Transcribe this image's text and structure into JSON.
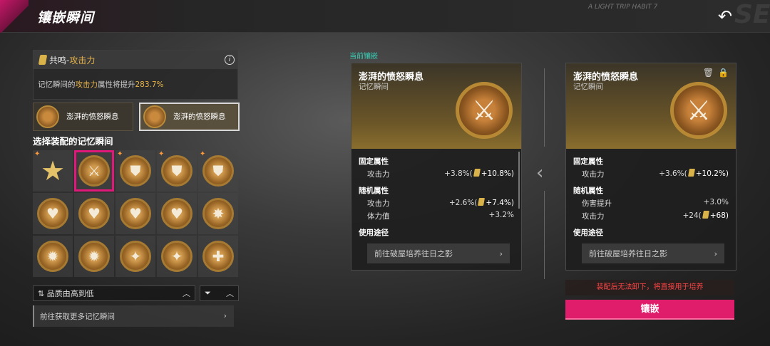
{
  "header": {
    "title": "镶嵌瞬间",
    "deco_text": "A LIGHT TRIP\nHABIT 7",
    "deco_letters": "SE"
  },
  "resonance": {
    "prefix": "共鸣-",
    "attribute": "攻击力",
    "desc_before": "记忆瞬间的",
    "desc_attr": "攻击力",
    "desc_middle": "属性将提升",
    "desc_value": "283.7%"
  },
  "slots": [
    {
      "label": "澎湃的愤怒瞬息"
    },
    {
      "label": "澎湃的愤怒瞬息"
    }
  ],
  "select_title": "选择装配的记忆瞬间",
  "grid": [
    {
      "icon": "star-icon",
      "glyph": "★",
      "new": true,
      "selected": false
    },
    {
      "icon": "sword-icon",
      "glyph": "⚔",
      "new": false,
      "selected": true
    },
    {
      "icon": "shield-icon",
      "glyph": "⛊",
      "new": true,
      "selected": false
    },
    {
      "icon": "shield-icon",
      "glyph": "⛊",
      "new": true,
      "selected": false
    },
    {
      "icon": "shield-icon",
      "glyph": "⛊",
      "new": true,
      "selected": false
    },
    {
      "icon": "heart-icon",
      "glyph": "♥",
      "new": false,
      "selected": false
    },
    {
      "icon": "heart-icon",
      "glyph": "♥",
      "new": false,
      "selected": false
    },
    {
      "icon": "heart-icon",
      "glyph": "♥",
      "new": false,
      "selected": false
    },
    {
      "icon": "heart-icon",
      "glyph": "♥",
      "new": false,
      "selected": false
    },
    {
      "icon": "burst-icon",
      "glyph": "✸",
      "new": false,
      "selected": false
    },
    {
      "icon": "flame-icon",
      "glyph": "✹",
      "new": false,
      "selected": false
    },
    {
      "icon": "flame-icon",
      "glyph": "✹",
      "new": false,
      "selected": false
    },
    {
      "icon": "shuriken-icon",
      "glyph": "✦",
      "new": false,
      "selected": false
    },
    {
      "icon": "shuriken-icon",
      "glyph": "✦",
      "new": false,
      "selected": false
    },
    {
      "icon": "cross-icon",
      "glyph": "✚",
      "new": false,
      "selected": false
    }
  ],
  "sort": {
    "label": "品质由高到低",
    "sort_glyph": "⇅",
    "filter_glyph": "⏷",
    "chevron": "︿"
  },
  "more_link": "前往获取更多记忆瞬间",
  "current_label": "当前镶嵌",
  "card_current": {
    "name": "澎湃的愤怒瞬息",
    "type": "记忆瞬间",
    "fixed_title": "固定属性",
    "fixed": [
      {
        "name": "攻击力",
        "value": "+3.8%(",
        "bonus": "+10.8%)"
      }
    ],
    "random_title": "随机属性",
    "random": [
      {
        "name": "攻击力",
        "value": "+2.6%(",
        "bonus": "+7.4%)",
        "coin": true
      },
      {
        "name": "体力值",
        "value": "+3.2%",
        "bonus": "",
        "coin": false
      }
    ],
    "usage_title": "使用途径",
    "route": "前往破屋培养往日之影"
  },
  "card_new": {
    "name": "澎湃的愤怒瞬息",
    "type": "记忆瞬间",
    "fixed_title": "固定属性",
    "fixed": [
      {
        "name": "攻击力",
        "value": "+3.6%(",
        "bonus": "+10.2%)"
      }
    ],
    "random_title": "随机属性",
    "random": [
      {
        "name": "伤害提升",
        "value": "+3.0%",
        "bonus": "",
        "coin": false
      },
      {
        "name": "攻击力",
        "value": "+24(",
        "bonus": "+68)",
        "coin": true
      }
    ],
    "usage_title": "使用途径",
    "route": "前往破屋培养往日之影"
  },
  "warning": "装配后无法卸下，将直接用于培养",
  "inlay_button": "镶嵌"
}
